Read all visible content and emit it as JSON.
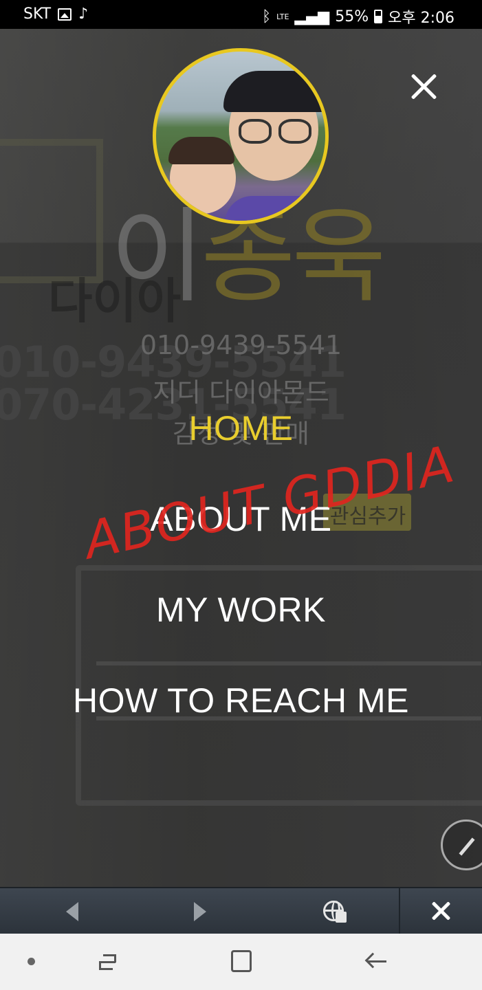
{
  "status_bar": {
    "carrier": "SKT",
    "network": "LTE",
    "battery": "55%",
    "time": "오후 2:06"
  },
  "background": {
    "name_part1": "이",
    "name_part2": "종욱",
    "sign_text": "다이아",
    "left_number1": "010-9439-5541",
    "left_number2": "070-4231-5541",
    "phone": "010-9439-5541",
    "business": "지디 다이아몬드",
    "tagline": "감정 및 판매",
    "badge": "관심추가"
  },
  "annotation": "ABOUT GDDIA",
  "menu": {
    "items": [
      {
        "label": "HOME",
        "active": true
      },
      {
        "label": "ABOUT ME",
        "active": false
      },
      {
        "label": "MY WORK",
        "active": false
      },
      {
        "label": "HOW TO REACH ME",
        "active": false
      }
    ]
  },
  "colors": {
    "accent": "#e8cd2e",
    "overlay": "#3b3b3b",
    "annotation": "#e0251f",
    "browser_bar": "#2c333b",
    "nav_bar": "#f1f1f1"
  },
  "icons": {
    "close": "close-icon",
    "edit": "pencil-icon",
    "back": "arrow-left-icon",
    "forward": "arrow-right-icon",
    "globe": "globe-icon",
    "browser_close": "close-icon"
  }
}
